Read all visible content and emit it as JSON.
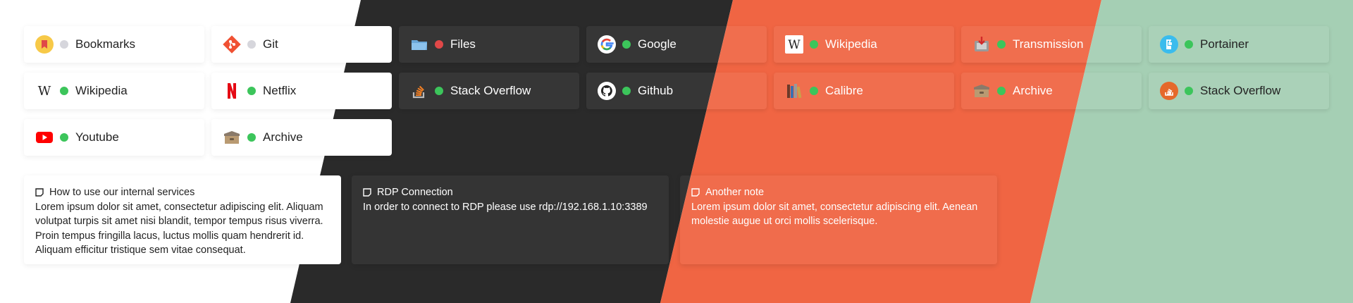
{
  "theme": {
    "colors": {
      "light": "#ffffff",
      "dark": "#2a2a2a",
      "coral": "#f06543",
      "sage": "#a5cfb4",
      "status_online": "#3cc55b",
      "status_offline": "#e04848",
      "status_unknown": "#d6d6dc"
    }
  },
  "services": [
    {
      "label": "Bookmarks",
      "icon": "bookmark-icon",
      "status": "unknown"
    },
    {
      "label": "Git",
      "icon": "git-icon",
      "status": "unknown"
    },
    {
      "label": "Files",
      "icon": "folder-icon",
      "status": "offline"
    },
    {
      "label": "Google",
      "icon": "google-icon",
      "status": "online"
    },
    {
      "label": "Wikipedia",
      "icon": "wikipedia-icon",
      "status": "online"
    },
    {
      "label": "Transmission",
      "icon": "transmission-icon",
      "status": "online"
    },
    {
      "label": "Portainer",
      "icon": "portainer-icon",
      "status": "online"
    },
    {
      "label": "Wikipedia",
      "icon": "wikipedia-icon",
      "status": "online"
    },
    {
      "label": "Netflix",
      "icon": "netflix-icon",
      "status": "online"
    },
    {
      "label": "Stack Overflow",
      "icon": "stackoverflow-icon",
      "status": "online"
    },
    {
      "label": "Github",
      "icon": "github-icon",
      "status": "online"
    },
    {
      "label": "Calibre",
      "icon": "calibre-icon",
      "status": "online"
    },
    {
      "label": "Archive",
      "icon": "archive-icon",
      "status": "online"
    },
    {
      "label": "Stack Overflow",
      "icon": "stackoverflow-icon",
      "status": "online"
    },
    {
      "label": "Youtube",
      "icon": "youtube-icon",
      "status": "online"
    },
    {
      "label": "Archive",
      "icon": "archive-icon",
      "status": "online"
    }
  ],
  "notes": [
    {
      "title": "How to use our internal services",
      "icon": "note-icon",
      "lines": [
        "Lorem ipsum dolor sit amet, consectetur adipiscing elit. Aliquam",
        "volutpat turpis sit amet nisi blandit, tempor tempus risus viverra.",
        "Proin tempus fringilla lacus, luctus mollis quam hendrerit id.",
        "Aliquam efficitur tristique sem vitae consequat."
      ]
    },
    {
      "title": "RDP Connection",
      "icon": "note-icon",
      "lines": [
        "In order to connect to RDP please use rdp://192.168.1.10:3389"
      ]
    },
    {
      "title": "Another note",
      "icon": "note-icon",
      "lines": [
        "Lorem ipsum dolor sit amet, consectetur adipiscing elit. Aenean",
        "molestie augue ut orci mollis scelerisque."
      ]
    }
  ]
}
